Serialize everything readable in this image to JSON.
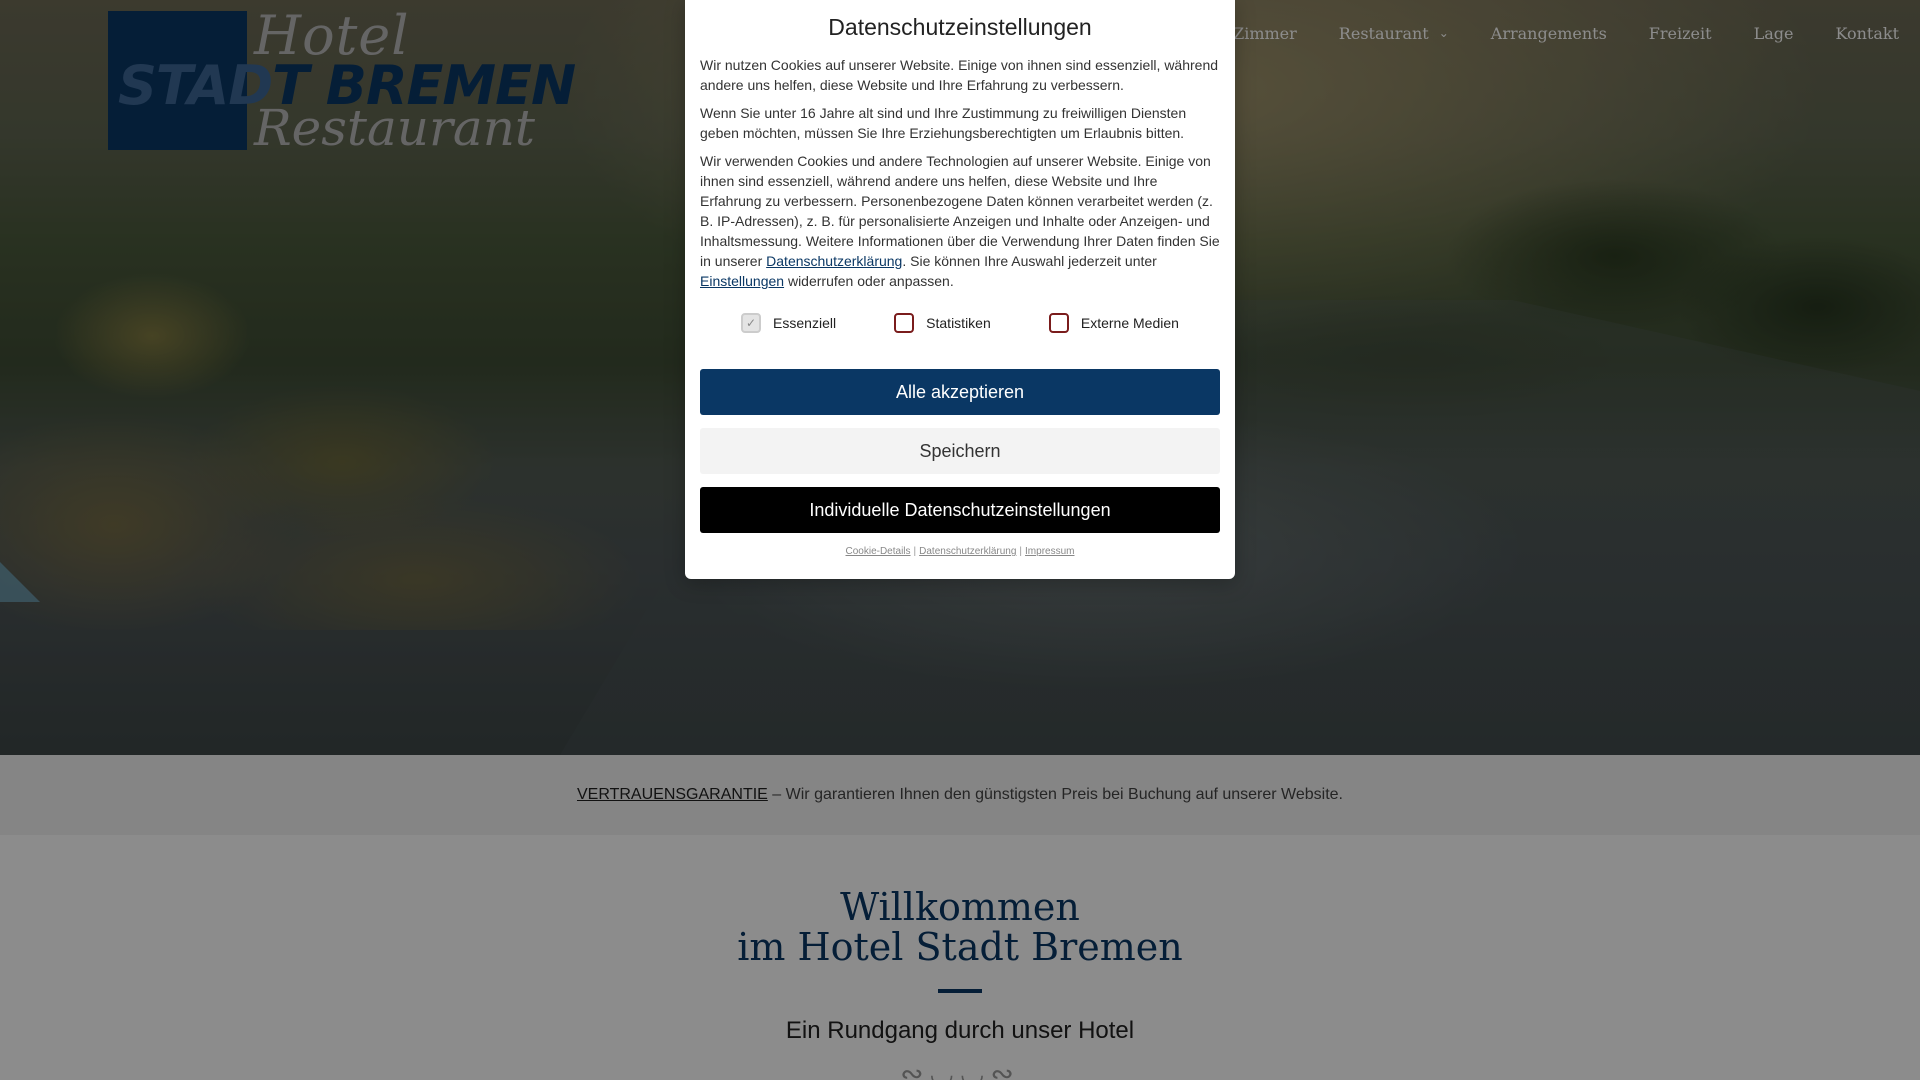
{
  "logo": {
    "line1": "Hotel",
    "line2": "STADT BREMEN",
    "line2_on_block": "STAD",
    "line2_rest": "T BREMEN",
    "line3": "Restaurant"
  },
  "nav": {
    "items": [
      {
        "label": "Zimmer",
        "has_dropdown": false
      },
      {
        "label": "Restaurant",
        "has_dropdown": true
      },
      {
        "label": "Arrangements",
        "has_dropdown": false
      },
      {
        "label": "Freizeit",
        "has_dropdown": false
      },
      {
        "label": "Lage",
        "has_dropdown": false
      },
      {
        "label": "Kontakt",
        "has_dropdown": false
      }
    ]
  },
  "trust": {
    "link_label": "VERTRAUENSGARANTIE",
    "text": " – Wir garantieren Ihnen den günstigsten Preis bei Buchung auf unserer Website."
  },
  "welcome": {
    "title_line1": "Willkommen",
    "title_line2": "im Hotel Stadt Bremen",
    "subtitle": "Ein Rundgang durch unser Hotel"
  },
  "consent": {
    "title": "Datenschutzeinstellungen",
    "para1": "Wir nutzen Cookies auf unserer Website. Einige von ihnen sind essenziell, während andere uns helfen, diese Website und Ihre Erfahrung zu verbessern.",
    "para2": "Wenn Sie unter 16 Jahre alt sind und Ihre Zustimmung zu freiwilligen Diensten geben möchten, müssen Sie Ihre Erziehungsberechtigten um Erlaubnis bitten.",
    "para3_a": "Wir verwenden Cookies und andere Technologien auf unserer Website. Einige von ihnen sind essenziell, während andere uns helfen, diese Website und Ihre Erfahrung zu verbessern. Personenbezogene Daten können verarbeitet werden (z. B. IP-Adressen), z. B. für personalisierte Anzeigen und Inhalte oder Anzeigen- und Inhaltsmessung. Weitere Informationen über die Verwendung Ihrer Daten finden Sie in unserer ",
    "para3_link1": "Datenschutzerklärung",
    "para3_b": ". Sie können Ihre Auswahl jederzeit unter ",
    "para3_link2": "Einstellungen",
    "para3_c": " widerrufen oder anpassen.",
    "checkboxes": [
      {
        "label": "Essenziell",
        "checked": true,
        "disabled": true
      },
      {
        "label": "Statistiken",
        "checked": false,
        "disabled": false
      },
      {
        "label": "Externe Medien",
        "checked": false,
        "disabled": false
      }
    ],
    "btn_accept": "Alle akzeptieren",
    "btn_save": "Speichern",
    "btn_individual": "Individuelle Datenschutzeinstellungen",
    "footer_links": [
      "Cookie-Details",
      "Datenschutzerklärung",
      "Impressum"
    ],
    "footer_sep": "|"
  },
  "colors": {
    "brand": "#0a3764",
    "logo_grey": "#b9b9b9",
    "checkbox_border": "#7a1c1c"
  },
  "icons": {
    "dropdown": "chevron-down-icon",
    "checkmark": "check-icon"
  }
}
